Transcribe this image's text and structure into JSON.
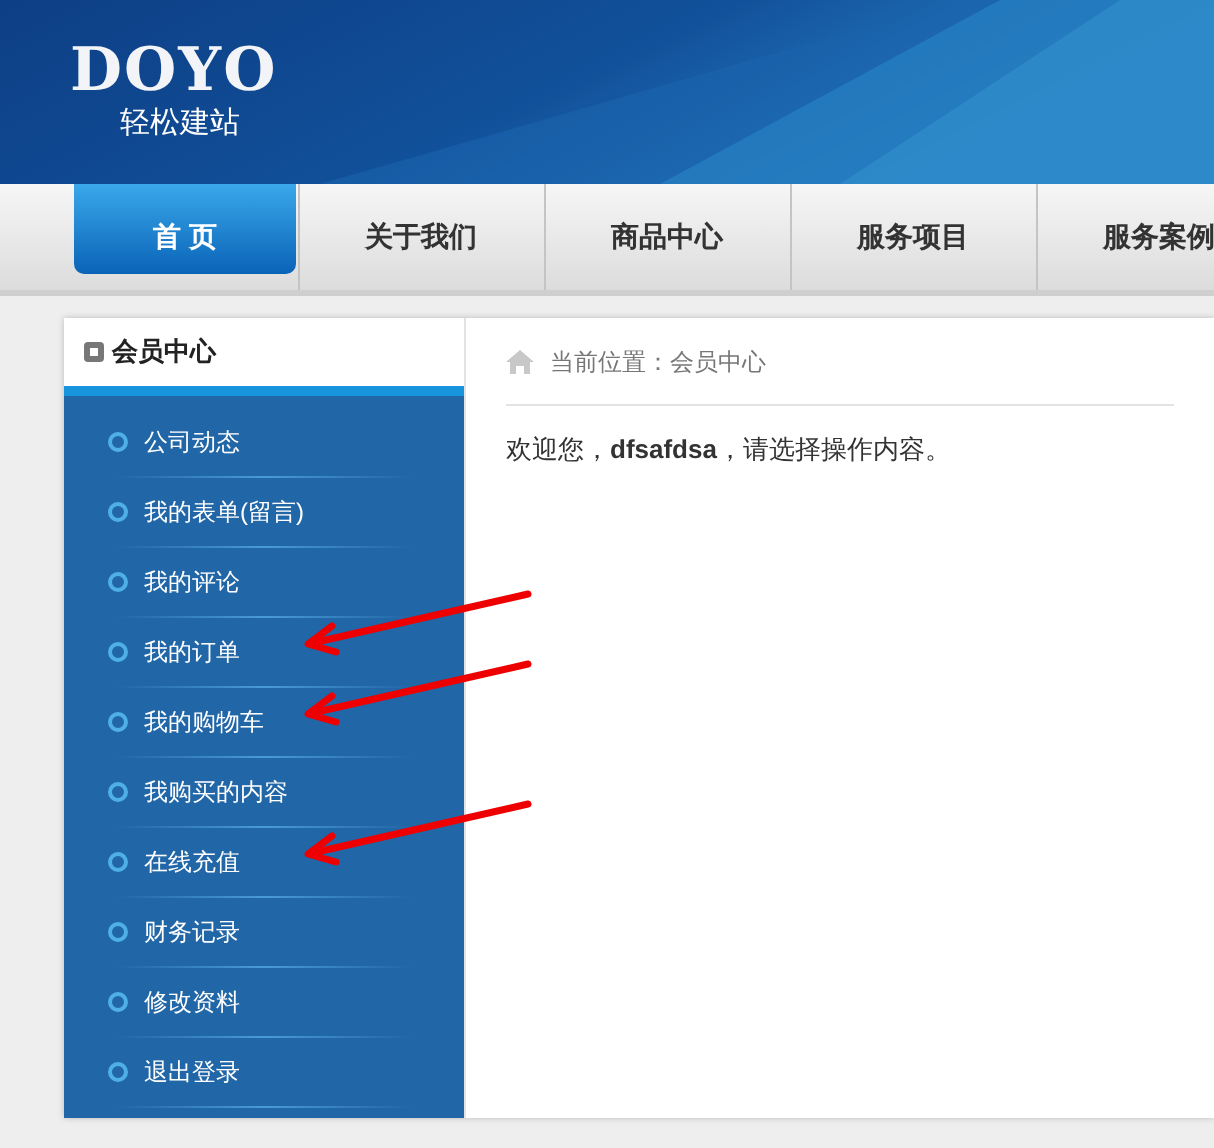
{
  "logo": {
    "wordmark": "DOYO",
    "tagline": "轻松建站"
  },
  "nav": [
    {
      "label": "首 页",
      "selected": true
    },
    {
      "label": "关于我们",
      "selected": false
    },
    {
      "label": "商品中心",
      "selected": false
    },
    {
      "label": "服务项目",
      "selected": false
    },
    {
      "label": "服务案例",
      "selected": false
    }
  ],
  "sidebar": {
    "title": "会员中心",
    "items": [
      {
        "label": "公司动态",
        "marked": false
      },
      {
        "label": "我的表单(留言)",
        "marked": false
      },
      {
        "label": "我的评论",
        "marked": false
      },
      {
        "label": "我的订单",
        "marked": true
      },
      {
        "label": "我的购物车",
        "marked": true
      },
      {
        "label": "我购买的内容",
        "marked": false
      },
      {
        "label": "在线充值",
        "marked": true
      },
      {
        "label": "财务记录",
        "marked": false
      },
      {
        "label": "修改资料",
        "marked": false
      },
      {
        "label": "退出登录",
        "marked": false
      }
    ]
  },
  "breadcrumb": "当前位置：会员中心",
  "welcome": "欢迎您，**dfsafdsa**，请选择操作内容。"
}
